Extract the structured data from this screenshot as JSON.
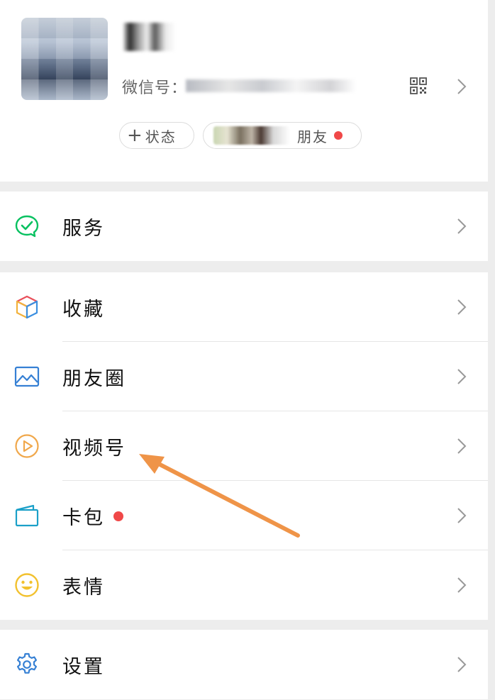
{
  "profile": {
    "wechat_id_label": "微信号：",
    "status_button": "状态",
    "friends_label": "朋友"
  },
  "menu": {
    "services": "服务",
    "favorites": "收藏",
    "moments": "朋友圈",
    "channels": "视频号",
    "card_package": "卡包",
    "stickers": "表情",
    "settings": "设置"
  },
  "colors": {
    "accent_green": "#07c160",
    "badge_red": "#f04848",
    "annotation_arrow": "#ef9448"
  }
}
